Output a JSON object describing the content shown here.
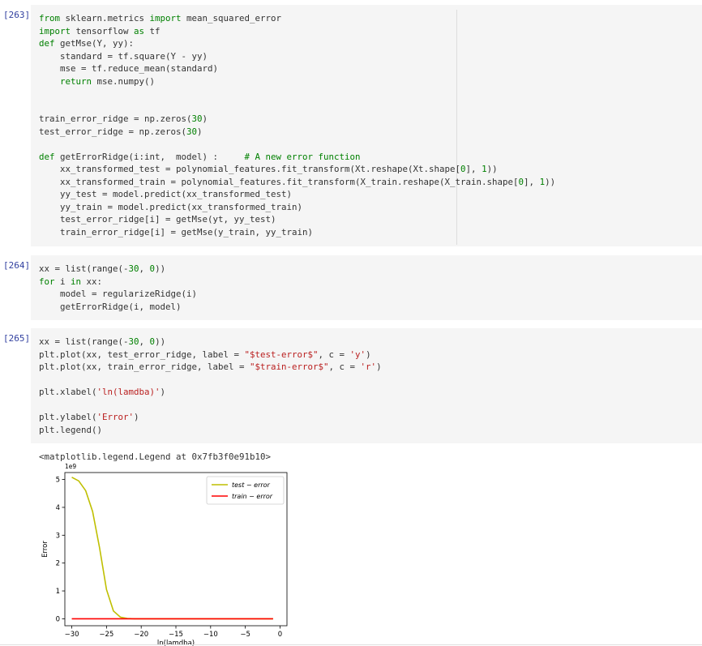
{
  "cells": [
    {
      "prompt": "[263]",
      "lines": [
        [
          [
            "kw",
            "from"
          ],
          [
            "t",
            " sklearn.metrics "
          ],
          [
            "kw",
            "import"
          ],
          [
            "t",
            " mean_squared_error"
          ]
        ],
        [
          [
            "kw",
            "import"
          ],
          [
            "t",
            " tensorflow "
          ],
          [
            "kw",
            "as"
          ],
          [
            "t",
            " tf"
          ]
        ],
        [
          [
            "kw",
            "def"
          ],
          [
            "t",
            " getMse(Y, yy):"
          ]
        ],
        [
          [
            "t",
            "    standard = tf.square(Y - yy)"
          ]
        ],
        [
          [
            "t",
            "    mse = tf.reduce_mean(standard)"
          ]
        ],
        [
          [
            "t",
            "    "
          ],
          [
            "kw",
            "return"
          ],
          [
            "t",
            " mse.numpy()"
          ]
        ],
        [
          [
            "t",
            ""
          ]
        ],
        [
          [
            "t",
            ""
          ]
        ],
        [
          [
            "t",
            "train_error_ridge = np.zeros("
          ],
          [
            "num",
            "30"
          ],
          [
            "t",
            ")"
          ]
        ],
        [
          [
            "t",
            "test_error_ridge = np.zeros("
          ],
          [
            "num",
            "30"
          ],
          [
            "t",
            ")"
          ]
        ],
        [
          [
            "t",
            ""
          ]
        ],
        [
          [
            "kw",
            "def"
          ],
          [
            "t",
            " getErrorRidge(i:int,  model) :     "
          ],
          [
            "com",
            "# A new error function"
          ]
        ],
        [
          [
            "t",
            "    xx_transformed_test = polynomial_features.fit_transform(Xt.reshape(Xt.shape["
          ],
          [
            "num",
            "0"
          ],
          [
            "t",
            "], "
          ],
          [
            "num",
            "1"
          ],
          [
            "t",
            "))"
          ]
        ],
        [
          [
            "t",
            "    xx_transformed_train = polynomial_features.fit_transform(X_train.reshape(X_train.shape["
          ],
          [
            "num",
            "0"
          ],
          [
            "t",
            "], "
          ],
          [
            "num",
            "1"
          ],
          [
            "t",
            "))"
          ]
        ],
        [
          [
            "t",
            "    yy_test = model.predict(xx_transformed_test)"
          ]
        ],
        [
          [
            "t",
            "    yy_train = model.predict(xx_transformed_train)"
          ]
        ],
        [
          [
            "t",
            "    test_error_ridge[i] = getMse(yt, yy_test)"
          ]
        ],
        [
          [
            "t",
            "    train_error_ridge[i] = getMse(y_train, yy_train)"
          ]
        ]
      ]
    },
    {
      "prompt": "[264]",
      "lines": [
        [
          [
            "t",
            "xx = list(range(-"
          ],
          [
            "num",
            "30"
          ],
          [
            "t",
            ", "
          ],
          [
            "num",
            "0"
          ],
          [
            "t",
            "))"
          ]
        ],
        [
          [
            "kw",
            "for"
          ],
          [
            "t",
            " i "
          ],
          [
            "kw",
            "in"
          ],
          [
            "t",
            " xx:"
          ]
        ],
        [
          [
            "t",
            "    model = regularizeRidge(i)"
          ]
        ],
        [
          [
            "t",
            "    getErrorRidge(i, model)"
          ]
        ]
      ]
    },
    {
      "prompt": "[265]",
      "lines": [
        [
          [
            "t",
            "xx = list(range(-"
          ],
          [
            "num",
            "30"
          ],
          [
            "t",
            ", "
          ],
          [
            "num",
            "0"
          ],
          [
            "t",
            "))"
          ]
        ],
        [
          [
            "t",
            "plt.plot(xx, test_error_ridge, label = "
          ],
          [
            "str",
            "\"$test-error$\""
          ],
          [
            "t",
            ", c = "
          ],
          [
            "str",
            "'y'"
          ],
          [
            "t",
            ")"
          ]
        ],
        [
          [
            "t",
            "plt.plot(xx, train_error_ridge, label = "
          ],
          [
            "str",
            "\"$train-error$\""
          ],
          [
            "t",
            ", c = "
          ],
          [
            "str",
            "'r'"
          ],
          [
            "t",
            ")"
          ]
        ],
        [
          [
            "t",
            ""
          ]
        ],
        [
          [
            "t",
            "plt.xlabel("
          ],
          [
            "str",
            "'ln(lamdba)'"
          ],
          [
            "t",
            ")"
          ]
        ],
        [
          [
            "t",
            ""
          ]
        ],
        [
          [
            "t",
            "plt.ylabel("
          ],
          [
            "str",
            "'Error'"
          ],
          [
            "t",
            ")"
          ]
        ],
        [
          [
            "t",
            "plt.legend()"
          ]
        ]
      ]
    }
  ],
  "output": {
    "text": "<matplotlib.legend.Legend at 0x7fb3f0e91b10>"
  },
  "chart_data": {
    "type": "line",
    "xlabel": "ln(lamdba)",
    "ylabel": "Error",
    "offset_text": "1e9",
    "xlim": [
      -31,
      1
    ],
    "ylim": [
      -0.25,
      5.25
    ],
    "xticks": [
      -30,
      -25,
      -20,
      -15,
      -10,
      -5,
      0
    ],
    "xtick_labels": [
      "−30",
      "−25",
      "−20",
      "−15",
      "−10",
      "−5",
      "0"
    ],
    "yticks": [
      0,
      1,
      2,
      3,
      4,
      5
    ],
    "ytick_labels": [
      "0",
      "1",
      "2",
      "3",
      "4",
      "5"
    ],
    "legend_position": "upper right",
    "series": [
      {
        "name": "test − error",
        "color": "#bfbf00",
        "x": [
          -30,
          -29,
          -28,
          -27,
          -26,
          -25,
          -24,
          -23,
          -22,
          -21,
          -20,
          -19,
          -18,
          -17,
          -16,
          -15,
          -14,
          -13,
          -12,
          -11,
          -10,
          -9,
          -8,
          -7,
          -6,
          -5,
          -4,
          -3,
          -2,
          -1
        ],
        "y": [
          5.08,
          4.95,
          4.6,
          3.85,
          2.55,
          1.05,
          0.28,
          0.06,
          0.01,
          0,
          0,
          0,
          0,
          0,
          0,
          0,
          0,
          0,
          0,
          0,
          0,
          0,
          0,
          0,
          0,
          0,
          0,
          0,
          0,
          0
        ]
      },
      {
        "name": "train − error",
        "color": "#ff0000",
        "x": [
          -30,
          -29,
          -28,
          -27,
          -26,
          -25,
          -24,
          -23,
          -22,
          -21,
          -20,
          -19,
          -18,
          -17,
          -16,
          -15,
          -14,
          -13,
          -12,
          -11,
          -10,
          -9,
          -8,
          -7,
          -6,
          -5,
          -4,
          -3,
          -2,
          -1
        ],
        "y": [
          0,
          0,
          0,
          0,
          0,
          0,
          0,
          0,
          0,
          0,
          0,
          0,
          0,
          0,
          0,
          0,
          0,
          0,
          0,
          0,
          0,
          0,
          0,
          0,
          0,
          0,
          0,
          0,
          0,
          0
        ]
      }
    ]
  }
}
